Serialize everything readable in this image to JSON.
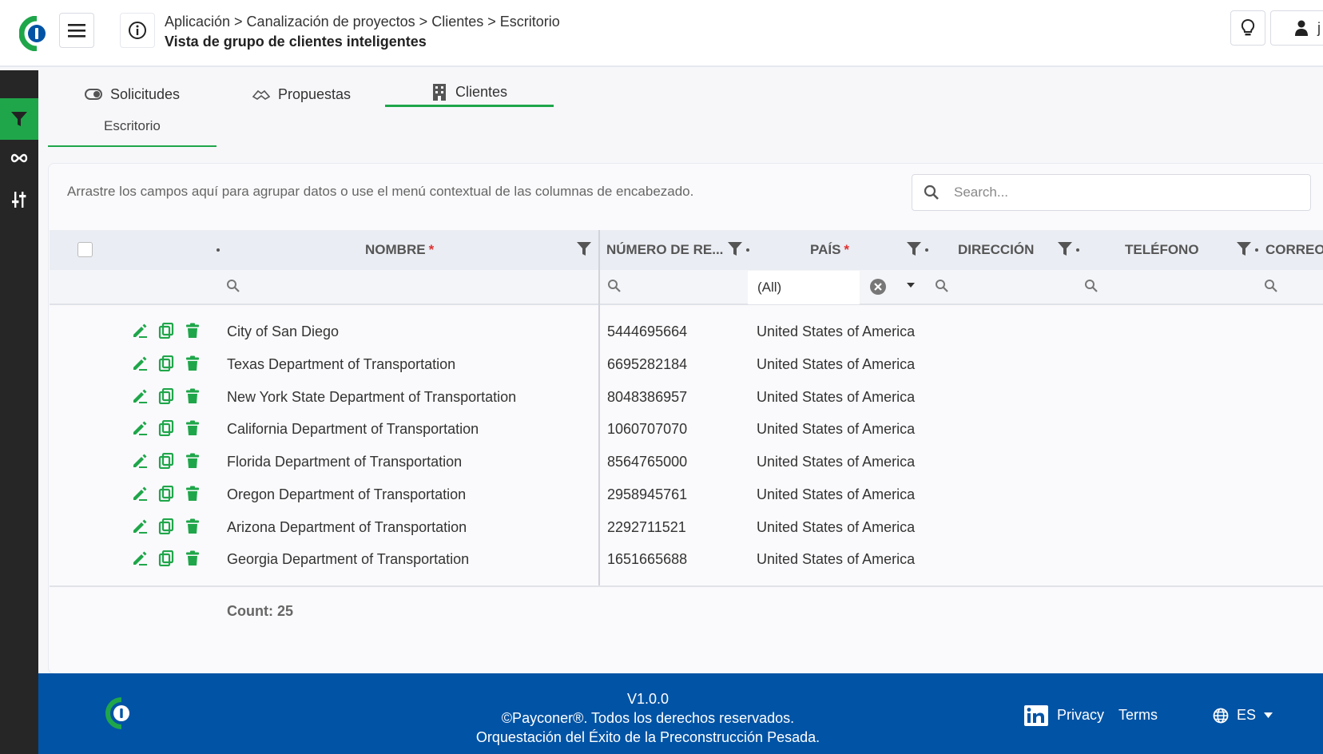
{
  "header": {
    "breadcrumb": "Aplicación > Canalización de proyectos > Clientes > Escritorio",
    "page_title": "Vista de grupo de clientes inteligentes",
    "user_initial": "j"
  },
  "tabs": [
    {
      "label": "Solicitudes",
      "icon": "toggle-icon"
    },
    {
      "label": "Propuestas",
      "icon": "handshake-icon"
    },
    {
      "label": "Clientes",
      "icon": "building-icon",
      "active": true
    }
  ],
  "subtab": "Escritorio",
  "grid": {
    "group_hint": "Arrastre los campos aquí para agrupar datos o use el menú contextual de las columnas de encabezado.",
    "search_placeholder": "Search...",
    "columns": [
      {
        "label": "NOMBRE",
        "required": true
      },
      {
        "label": "NÚMERO DE RE...",
        "required": false
      },
      {
        "label": "PAÍS",
        "required": true
      },
      {
        "label": "DIRECCIÓN",
        "required": false
      },
      {
        "label": "TELÉFONO",
        "required": false
      },
      {
        "label": "CORREO",
        "required": false
      }
    ],
    "country_filter_value": "(All)",
    "rows": [
      {
        "name": "City of San Diego",
        "number": "5444695664",
        "country": "United States of America"
      },
      {
        "name": "Texas Department of Transportation",
        "number": "6695282184",
        "country": "United States of America"
      },
      {
        "name": "New York State Department of Transportation",
        "number": "8048386957",
        "country": "United States of America"
      },
      {
        "name": "California Department of Transportation",
        "number": "1060707070",
        "country": "United States of America"
      },
      {
        "name": "Florida Department of Transportation",
        "number": "8564765000",
        "country": "United States of America"
      },
      {
        "name": "Oregon Department of Transportation",
        "number": "2958945761",
        "country": "United States of America"
      },
      {
        "name": "Arizona Department of Transportation",
        "number": "2292711521",
        "country": "United States of America"
      },
      {
        "name": "Georgia Department of Transportation",
        "number": "1651665688",
        "country": "United States of America"
      }
    ],
    "count_label": "Count: 25"
  },
  "footer": {
    "version": "V1.0.0",
    "copyright": "©Payconer®. Todos los derechos reservados.",
    "tagline": "Orquestación del Éxito de la Preconstrucción Pesada.",
    "privacy": "Privacy",
    "terms": "Terms",
    "language": "ES"
  },
  "colors": {
    "accent": "#1fa64a",
    "footer_bg": "#0153a5",
    "rail_bg": "#262626",
    "required": "#e03131"
  }
}
